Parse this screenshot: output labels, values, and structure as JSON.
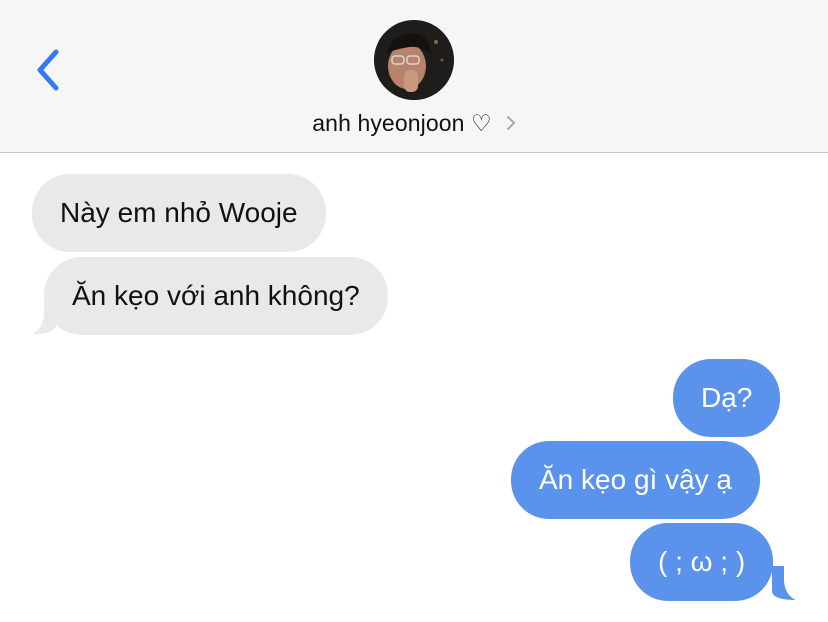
{
  "header": {
    "contact_name": "anh hyeonjoon ♡"
  },
  "messages": [
    {
      "side": "incoming",
      "text": "Này em nhỏ Wooje"
    },
    {
      "side": "incoming",
      "text": "Ăn kẹo với anh không?"
    },
    {
      "side": "outgoing",
      "text": "Dạ?"
    },
    {
      "side": "outgoing",
      "text": "Ăn kẹo gì vậy ạ"
    },
    {
      "side": "outgoing",
      "text": "( ; ω ; )"
    }
  ],
  "colors": {
    "incoming_bubble": "#e9e9eb",
    "outgoing_bubble": "#5b93ec",
    "accent": "#3478f6"
  }
}
